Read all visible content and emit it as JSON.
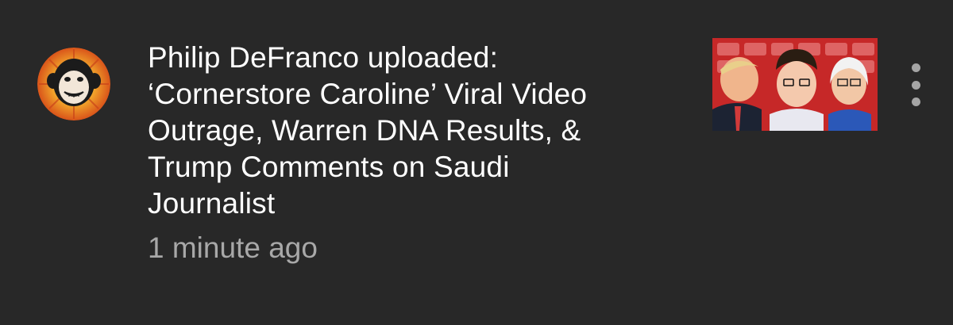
{
  "notification": {
    "message": "Philip DeFranco uploaded:\n‘Cornerstore Caroline’ Viral Video\nOutrage, Warren DNA Results, &\nTrump Comments on Saudi\nJournalist",
    "timestamp": "1 minute ago",
    "avatar_icon": "monkey-logo-icon",
    "thumbnail_icon": "video-thumbnail",
    "menu_icon": "more-vertical-icon"
  },
  "colors": {
    "background": "#282828",
    "text": "#ffffff",
    "secondary_text": "#a8a8a8",
    "avatar_ring": "#e8641c",
    "thumbnail_red": "#c62828"
  }
}
